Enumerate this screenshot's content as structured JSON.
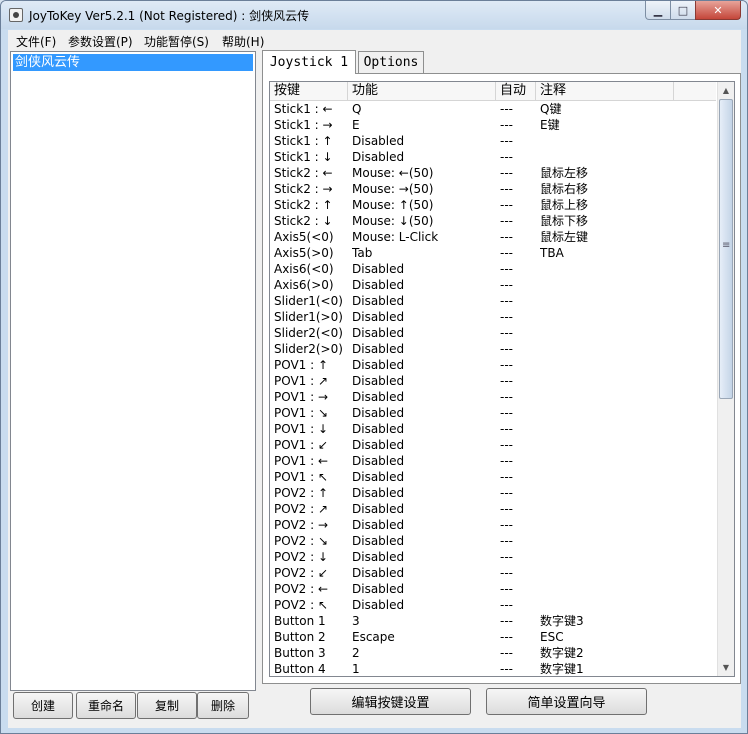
{
  "window": {
    "title": "JoyToKey Ver5.2.1 (Not Registered) : 剑侠风云传"
  },
  "menu": [
    "文件(F)",
    "参数设置(P)",
    "功能暂停(S)",
    "帮助(H)"
  ],
  "profiles": {
    "selected": "剑侠风云传"
  },
  "profile_buttons": [
    "创建",
    "重命名",
    "复制",
    "删除"
  ],
  "tabs": [
    "Joystick 1",
    "Options"
  ],
  "table": {
    "headers": [
      "按键",
      "功能",
      "自动",
      "注释"
    ],
    "rows": [
      [
        "Stick1 : ←",
        "Q",
        "---",
        "Q键"
      ],
      [
        "Stick1 : →",
        "E",
        "---",
        "E键"
      ],
      [
        "Stick1 : ↑",
        "Disabled",
        "---",
        ""
      ],
      [
        "Stick1 : ↓",
        "Disabled",
        "---",
        ""
      ],
      [
        "Stick2 : ←",
        "Mouse: ←(50)",
        "---",
        "鼠标左移"
      ],
      [
        "Stick2 : →",
        "Mouse: →(50)",
        "---",
        "鼠标右移"
      ],
      [
        "Stick2 : ↑",
        "Mouse: ↑(50)",
        "---",
        "鼠标上移"
      ],
      [
        "Stick2 : ↓",
        "Mouse: ↓(50)",
        "---",
        "鼠标下移"
      ],
      [
        "Axis5(<0)",
        "Mouse: L-Click",
        "---",
        "鼠标左键"
      ],
      [
        "Axis5(>0)",
        "Tab",
        "---",
        "TBA"
      ],
      [
        "Axis6(<0)",
        "Disabled",
        "---",
        ""
      ],
      [
        "Axis6(>0)",
        "Disabled",
        "---",
        ""
      ],
      [
        "Slider1(<0)",
        "Disabled",
        "---",
        ""
      ],
      [
        "Slider1(>0)",
        "Disabled",
        "---",
        ""
      ],
      [
        "Slider2(<0)",
        "Disabled",
        "---",
        ""
      ],
      [
        "Slider2(>0)",
        "Disabled",
        "---",
        ""
      ],
      [
        "POV1 : ↑",
        "Disabled",
        "---",
        ""
      ],
      [
        "POV1 : ↗",
        "Disabled",
        "---",
        ""
      ],
      [
        "POV1 : →",
        "Disabled",
        "---",
        ""
      ],
      [
        "POV1 : ↘",
        "Disabled",
        "---",
        ""
      ],
      [
        "POV1 : ↓",
        "Disabled",
        "---",
        ""
      ],
      [
        "POV1 : ↙",
        "Disabled",
        "---",
        ""
      ],
      [
        "POV1 : ←",
        "Disabled",
        "---",
        ""
      ],
      [
        "POV1 : ↖",
        "Disabled",
        "---",
        ""
      ],
      [
        "POV2 : ↑",
        "Disabled",
        "---",
        ""
      ],
      [
        "POV2 : ↗",
        "Disabled",
        "---",
        ""
      ],
      [
        "POV2 : →",
        "Disabled",
        "---",
        ""
      ],
      [
        "POV2 : ↘",
        "Disabled",
        "---",
        ""
      ],
      [
        "POV2 : ↓",
        "Disabled",
        "---",
        ""
      ],
      [
        "POV2 : ↙",
        "Disabled",
        "---",
        ""
      ],
      [
        "POV2 : ←",
        "Disabled",
        "---",
        ""
      ],
      [
        "POV2 : ↖",
        "Disabled",
        "---",
        ""
      ],
      [
        "Button 1",
        "3",
        "---",
        "数字键3"
      ],
      [
        "Button 2",
        "Escape",
        "---",
        "ESC"
      ],
      [
        "Button 3",
        "2",
        "---",
        "数字键2"
      ],
      [
        "Button 4",
        "1",
        "---",
        "数字键1"
      ]
    ]
  },
  "bottom_buttons": [
    "编辑按键设置",
    "简单设置向导"
  ],
  "icons": [
    "app-icon",
    "minimize-icon",
    "maximize-icon",
    "close-icon",
    "scroll-up-icon",
    "scroll-down-icon"
  ],
  "colors": {
    "selection": "#3399ff",
    "close_button": "#c4463a"
  }
}
